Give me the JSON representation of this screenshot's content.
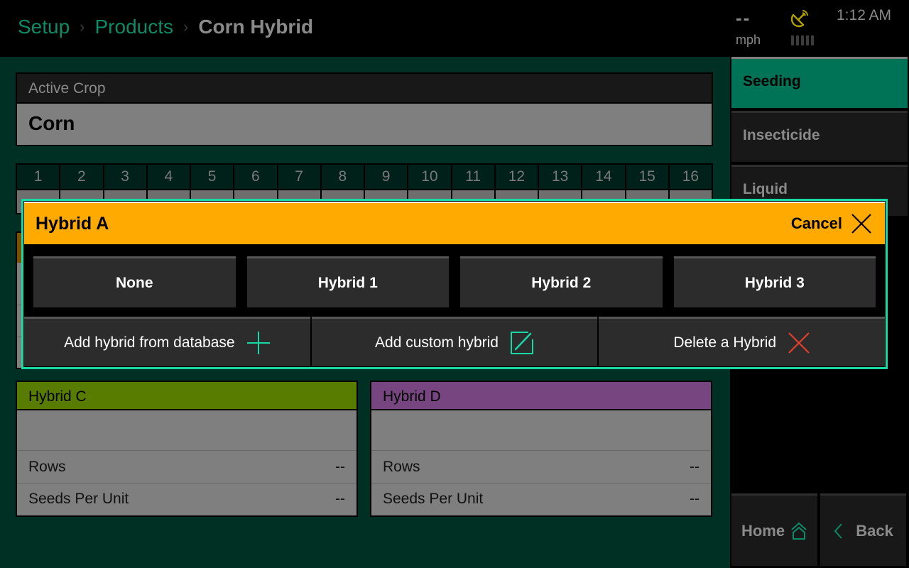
{
  "header": {
    "breadcrumb": [
      {
        "label": "Setup"
      },
      {
        "label": "Products"
      }
    ],
    "current": "Corn Hybrid",
    "separator_icon": "chevron-right-icon",
    "speed_value": "--",
    "speed_unit": "mph",
    "gps_icon": "satellite-dish-icon",
    "gps_signal_bars": 5,
    "clock": "1:12 AM"
  },
  "active_crop": {
    "label": "Active Crop",
    "value": "Corn"
  },
  "rows": [
    "1",
    "2",
    "3",
    "4",
    "5",
    "6",
    "7",
    "8",
    "9",
    "10",
    "11",
    "12",
    "13",
    "14",
    "15",
    "16"
  ],
  "hybrid_cards": [
    {
      "title": "Hybrid C",
      "color": "#577c00",
      "rows_label": "Rows",
      "rows_value": "--",
      "seeds_label": "Seeds Per Unit",
      "seeds_value": "--"
    },
    {
      "title": "Hybrid D",
      "color": "#77457f",
      "rows_label": "Rows",
      "rows_value": "--",
      "seeds_label": "Seeds Per Unit",
      "seeds_value": "--"
    }
  ],
  "sidebar": {
    "tabs": [
      {
        "label": "Seeding",
        "active": true
      },
      {
        "label": "Insecticide",
        "active": false
      },
      {
        "label": "Liquid",
        "active": false
      }
    ],
    "home_label": "Home",
    "back_label": "Back"
  },
  "modal": {
    "title": "Hybrid A",
    "header_color": "#ffaa00",
    "cancel_label": "Cancel",
    "options": [
      "None",
      "Hybrid 1",
      "Hybrid 2",
      "Hybrid 3"
    ],
    "actions": [
      {
        "label": "Add hybrid from database",
        "icon": "plus-icon"
      },
      {
        "label": "Add custom hybrid",
        "icon": "edit-icon"
      },
      {
        "label": "Delete a Hybrid",
        "icon": "delete-x-icon"
      }
    ]
  },
  "colors": {
    "accent": "#0d8a66",
    "modal_border": "#16d9a6",
    "delete": "#e8402a",
    "gps": "#b0a000"
  }
}
